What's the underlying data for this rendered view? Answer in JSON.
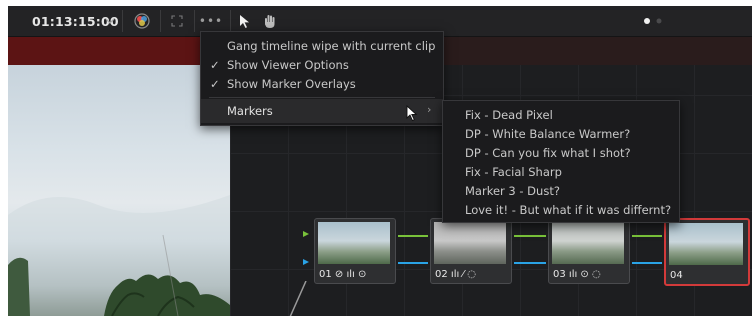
{
  "toolbar": {
    "timecode": "01:13:15:00",
    "timecode_dropdown_icon": "chevron-down-icon",
    "color_wheel_icon": "color-wheel-icon",
    "fullscreen_icon": "fullscreen-icon",
    "more_options_icon": "ellipsis-icon",
    "pointer_icon": "pointer-icon",
    "hand_icon": "hand-icon",
    "page_dots_icon": "page-dots-icon"
  },
  "menu": {
    "items": [
      {
        "label": "Gang timeline wipe with current clip",
        "checked": false
      },
      {
        "label": "Show Viewer Options",
        "checked": true
      },
      {
        "label": "Show Marker Overlays",
        "checked": true
      }
    ],
    "check_glyph": "✓",
    "markers_label": "Markers",
    "submenu_arrow": "›"
  },
  "markers_submenu": {
    "items": [
      "Fix - Dead Pixel",
      "DP - White Balance Warmer?",
      "DP - Can you fix what I shot?",
      "Fix - Facial Sharp",
      "Marker 3 - Dust?",
      "Love it! - But what if it was differnt?"
    ]
  },
  "nodes": [
    {
      "number": "01",
      "tools": "⊘ ılı ⊙"
    },
    {
      "number": "02",
      "tools": "ılı ⁄ ◌"
    },
    {
      "number": "03",
      "tools": "ılı ⊙ ◌"
    },
    {
      "number": "04",
      "tools": ""
    }
  ],
  "colors": {
    "toolbar_bg": "#232325",
    "menu_bg": "#1b1b1d",
    "node_graph_bg": "#1d1e20",
    "rgb_wire": "#79c23a",
    "alpha_wire": "#2aa3e6",
    "selected_node_border": "#d23a3a",
    "viewer_marker_bar": "#5c1414"
  }
}
